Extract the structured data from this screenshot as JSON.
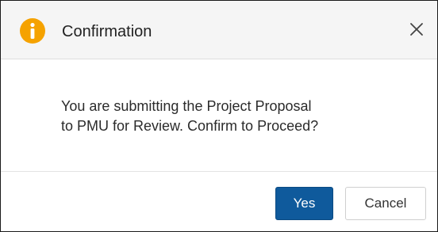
{
  "dialog": {
    "title": "Confirmation",
    "icon": "info-icon",
    "message_line1": "You are submitting the Project Proposal",
    "message_line2": "to PMU for Review. Confirm to Proceed?",
    "close_icon": "close-icon"
  },
  "buttons": {
    "yes_label": "Yes",
    "cancel_label": "Cancel"
  },
  "colors": {
    "accent": "#0f5a9c",
    "info_icon": "#f5a200",
    "header_bg": "#f5f5f5"
  }
}
